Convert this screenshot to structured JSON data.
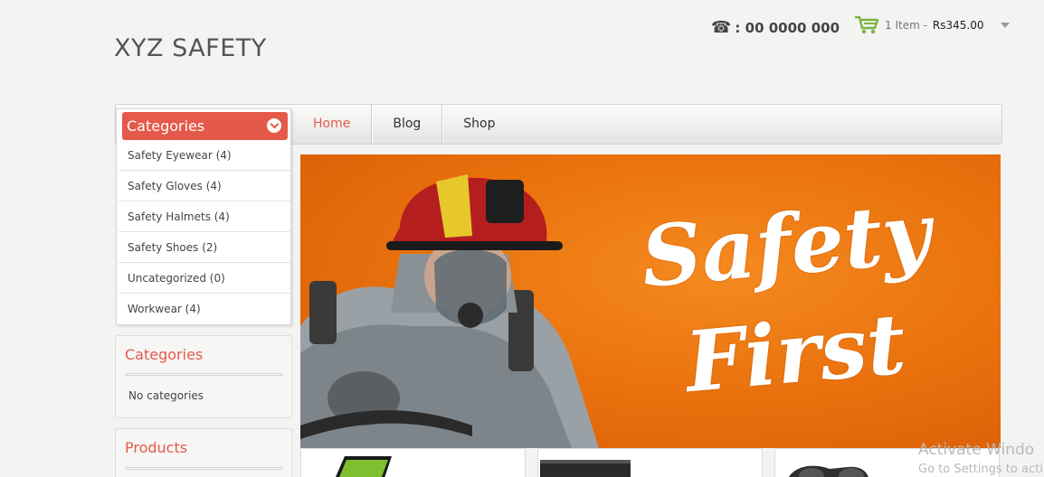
{
  "header": {
    "site_title": "XYZ SAFETY",
    "phone_icon": "☎",
    "phone": ": 00 0000 000",
    "cart": {
      "items": "1 Item -",
      "total": "Rs345.00"
    }
  },
  "nav": {
    "items": [
      {
        "label": "Home",
        "active": true
      },
      {
        "label": "Blog",
        "active": false
      },
      {
        "label": "Shop",
        "active": false
      }
    ]
  },
  "categories_panel": {
    "title": "Categories",
    "items": [
      {
        "label": "Safety Eyewear (4)"
      },
      {
        "label": "Safety Gloves (4)"
      },
      {
        "label": "Safety Halmets (4)"
      },
      {
        "label": "Safety Shoes (2)"
      },
      {
        "label": "Uncategorized (0)"
      },
      {
        "label": "Workwear (4)"
      }
    ]
  },
  "widgets": {
    "categories": {
      "title": "Categories",
      "text": "No categories"
    },
    "products": {
      "title": "Products"
    }
  },
  "slider": {
    "line1": "Safety",
    "line2": "First"
  },
  "watermark": {
    "line1": "Activate Windo",
    "line2": "Go to Settings to acti"
  },
  "colors": {
    "accent": "#e5594b",
    "slider_bg": "#ee7a14",
    "cart_green": "#7cb342"
  }
}
